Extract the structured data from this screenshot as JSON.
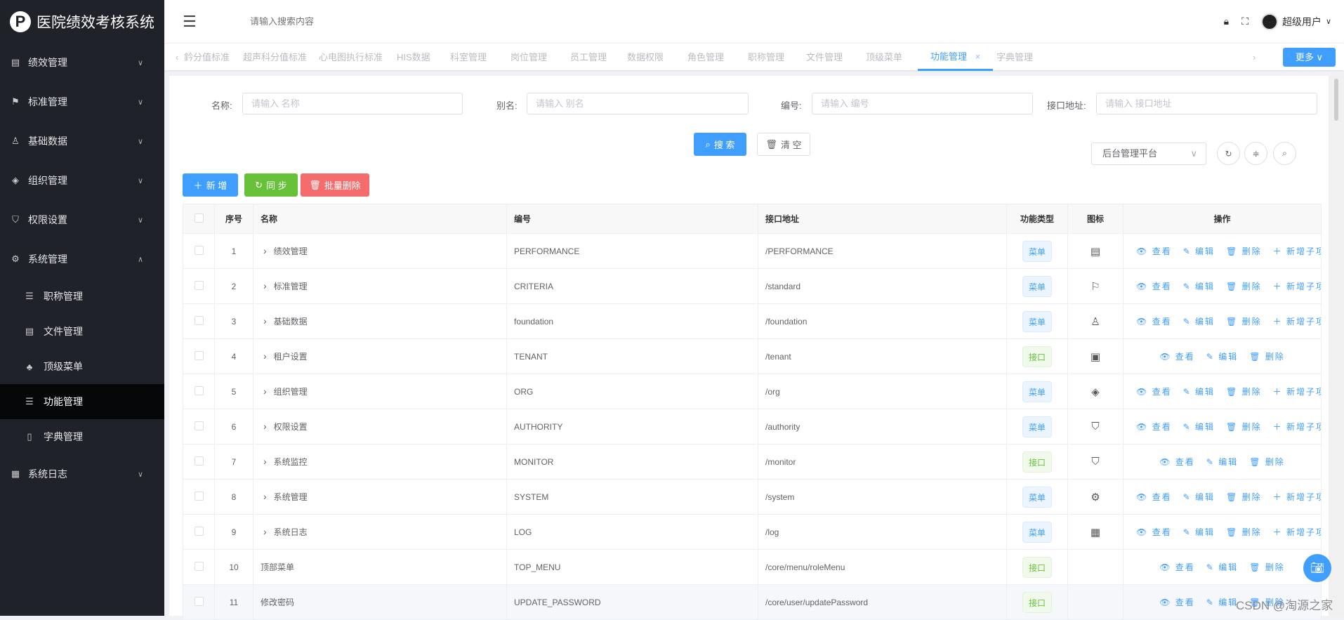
{
  "app": {
    "title": "医院绩效考核系统"
  },
  "header": {
    "search_placeholder": "请输入搜索内容",
    "user": "超级用户"
  },
  "sidebar": {
    "items": [
      {
        "label": "绩效管理",
        "icon": "document-icon",
        "glyph": "▤",
        "expanded": false
      },
      {
        "label": "标准管理",
        "icon": "flag-icon",
        "glyph": "⚑",
        "expanded": false
      },
      {
        "label": "基础数据",
        "icon": "user-icon",
        "glyph": "♙",
        "expanded": false
      },
      {
        "label": "组织管理",
        "icon": "tag-icon",
        "glyph": "◈",
        "expanded": false
      },
      {
        "label": "权限设置",
        "icon": "shield-check-icon",
        "glyph": "⛉",
        "expanded": false
      },
      {
        "label": "系统管理",
        "icon": "gear-icon",
        "glyph": "⚙",
        "expanded": true
      }
    ],
    "sub_items": [
      {
        "label": "职称管理",
        "icon": "list-icon",
        "glyph": "☰"
      },
      {
        "label": "文件管理",
        "icon": "document-icon",
        "glyph": "▤"
      },
      {
        "label": "顶级菜单",
        "icon": "org-chart-icon",
        "glyph": "♣"
      },
      {
        "label": "功能管理",
        "icon": "list-icon",
        "glyph": "☰",
        "active": true
      },
      {
        "label": "字典管理",
        "icon": "book-icon",
        "glyph": "▯"
      }
    ],
    "last_item": {
      "label": "系统日志",
      "icon": "log-icon",
      "glyph": "▦"
    }
  },
  "tabs": [
    "鈐分值标准",
    "超声科分值标准",
    "心电图执行标准",
    "HIS数据",
    "科室管理",
    "岗位管理",
    "员工管理",
    "数据权限",
    "角色管理",
    "职称管理",
    "文件管理",
    "顶级菜单",
    "功能管理",
    "字典管理"
  ],
  "active_tab": "功能管理",
  "more_label": "更多",
  "search_form": {
    "name_label": "名称:",
    "name_placeholder": "请输入 名称",
    "alias_label": "别名:",
    "alias_placeholder": "请输入 别名",
    "code_label": "编号:",
    "code_placeholder": "请输入 编号",
    "url_label": "接口地址:",
    "url_placeholder": "请输入 接口地址",
    "search_btn": "搜 索",
    "clear_btn": "清 空"
  },
  "toolbar": {
    "add": "新 增",
    "sync": "同 步",
    "batch_delete": "批量删除",
    "platform": "后台管理平台"
  },
  "table": {
    "headers": [
      "序号",
      "名称",
      "编号",
      "接口地址",
      "功能类型",
      "图标",
      "操作"
    ],
    "actions": {
      "view": "查看",
      "edit": "编辑",
      "delete": "删除",
      "add_child": "新增子项"
    },
    "rows": [
      {
        "no": "1",
        "name": "绩效管理",
        "expandable": true,
        "code": "PERFORMANCE",
        "url": "/PERFORMANCE",
        "type": "菜单",
        "icon": "document-icon",
        "glyph": "▤"
      },
      {
        "no": "2",
        "name": "标准管理",
        "expandable": true,
        "code": "CRITERIA",
        "url": "/standard",
        "type": "菜单",
        "icon": "flag-icon",
        "glyph": "⚐"
      },
      {
        "no": "3",
        "name": "基础数据",
        "expandable": true,
        "code": "foundation",
        "url": "/foundation",
        "type": "菜单",
        "icon": "user-icon",
        "glyph": "♙"
      },
      {
        "no": "4",
        "name": "租户设置",
        "expandable": true,
        "code": "TENANT",
        "url": "/tenant",
        "type": "接口",
        "icon": "tools-icon",
        "glyph": "▣"
      },
      {
        "no": "5",
        "name": "组织管理",
        "expandable": true,
        "code": "ORG",
        "url": "/org",
        "type": "菜单",
        "icon": "tag-icon",
        "glyph": "◈"
      },
      {
        "no": "6",
        "name": "权限设置",
        "expandable": true,
        "code": "AUTHORITY",
        "url": "/authority",
        "type": "菜单",
        "icon": "shield-check-icon",
        "glyph": "⛉"
      },
      {
        "no": "7",
        "name": "系统监控",
        "expandable": true,
        "code": "MONITOR",
        "url": "/monitor",
        "type": "接口",
        "icon": "shield-t-icon",
        "glyph": "⛉"
      },
      {
        "no": "8",
        "name": "系统管理",
        "expandable": true,
        "code": "SYSTEM",
        "url": "/system",
        "type": "菜单",
        "icon": "gear-icon",
        "glyph": "⚙"
      },
      {
        "no": "9",
        "name": "系统日志",
        "expandable": true,
        "code": "LOG",
        "url": "/log",
        "type": "菜单",
        "icon": "log-icon",
        "glyph": "▦"
      },
      {
        "no": "10",
        "name": "顶部菜单",
        "expandable": false,
        "code": "TOP_MENU",
        "url": "/core/menu/roleMenu",
        "type": "接口",
        "icon": "",
        "glyph": ""
      },
      {
        "no": "11",
        "name": "修改密码",
        "expandable": false,
        "code": "UPDATE_PASSWORD",
        "url": "/core/user/updatePassword",
        "type": "接口",
        "icon": "",
        "glyph": ""
      }
    ]
  },
  "watermark": "CSDN @淘源之家",
  "colors": {
    "primary": "#409eff",
    "success": "#67c23a",
    "danger": "#f56c6c",
    "sidebar": "#20222a"
  }
}
